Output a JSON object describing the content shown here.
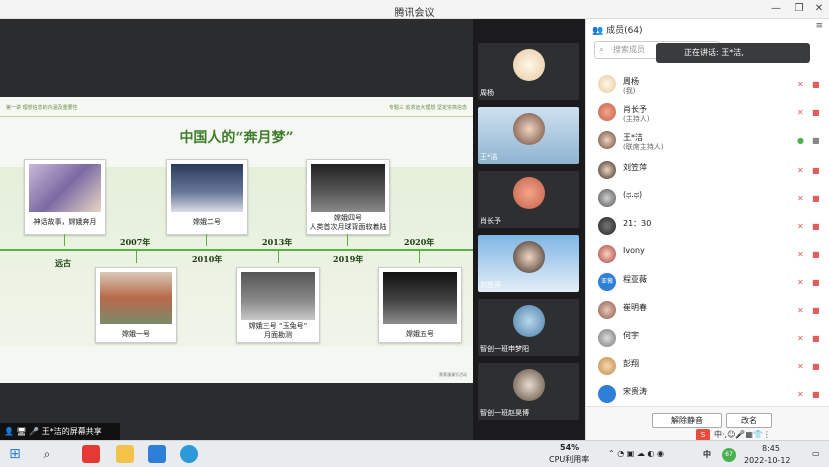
{
  "window": {
    "title": "腾讯会议"
  },
  "share": {
    "label": "王*洁的屏幕共享",
    "slide": {
      "header_left": "第一讲 理想信念的内涵及重要性",
      "header_right": "专题三 追求远大理想  坚定崇高信念",
      "title": "中国人的“奔月梦”",
      "footer": "票票漫漫号活动",
      "cards": [
        {
          "caption": "神话故事，嫦娥奔月"
        },
        {
          "caption": "嫦娥二号"
        },
        {
          "caption": "嫦娥四号\n人类首次月球背面软着陆"
        },
        {
          "caption": "嫦娥一号"
        },
        {
          "caption": "嫦娥三号 “玉兔号”\n月面勘测"
        },
        {
          "caption": "嫦娥五号"
        }
      ],
      "years": {
        "y2007": "2007年",
        "y2013": "2013年",
        "y2020": "2020年",
        "yuangu": "远古",
        "y2010": "2010年",
        "y2019": "2019年"
      }
    }
  },
  "videos": [
    {
      "name": "周杨"
    },
    {
      "name": "王*洁"
    },
    {
      "name": "肖长予"
    },
    {
      "name": "刘笠萍"
    },
    {
      "name": "智创一班申梦阳"
    },
    {
      "name": "智创一班赵昊博"
    }
  ],
  "panel": {
    "title": "成员(64)",
    "search_placeholder": "搜索成员",
    "speaking": "正在讲话: 王*洁,",
    "members": [
      {
        "name": "周杨",
        "sub": "(我)"
      },
      {
        "name": "肖长予",
        "sub": "(主持人)"
      },
      {
        "name": "王*洁",
        "sub": "(联席主持人)"
      },
      {
        "name": "刘笠萍",
        "sub": ""
      },
      {
        "name": "(ಥ.ಥ)",
        "sub": ""
      },
      {
        "name": "21：30",
        "sub": ""
      },
      {
        "name": "Ivony",
        "sub": ""
      },
      {
        "name": "程亚薇",
        "sub": ""
      },
      {
        "name": "崔明春",
        "sub": ""
      },
      {
        "name": "何宇",
        "sub": ""
      },
      {
        "name": "彭翔",
        "sub": ""
      },
      {
        "name": "宋贵涛",
        "sub": ""
      }
    ],
    "unmute_all": "解除静音",
    "rename": "改名",
    "avatar_text_cheng": "亚薇"
  },
  "taskbar": {
    "cpu_percent": "54%",
    "cpu_label": "CPU利用率",
    "time": "8:45",
    "date": "2022-10-12",
    "ime": "中",
    "badge": "67"
  },
  "colors": {
    "accent_green": "#5bb03f",
    "muted_red": "#e25c5c",
    "title_green": "#3d7d2a"
  }
}
